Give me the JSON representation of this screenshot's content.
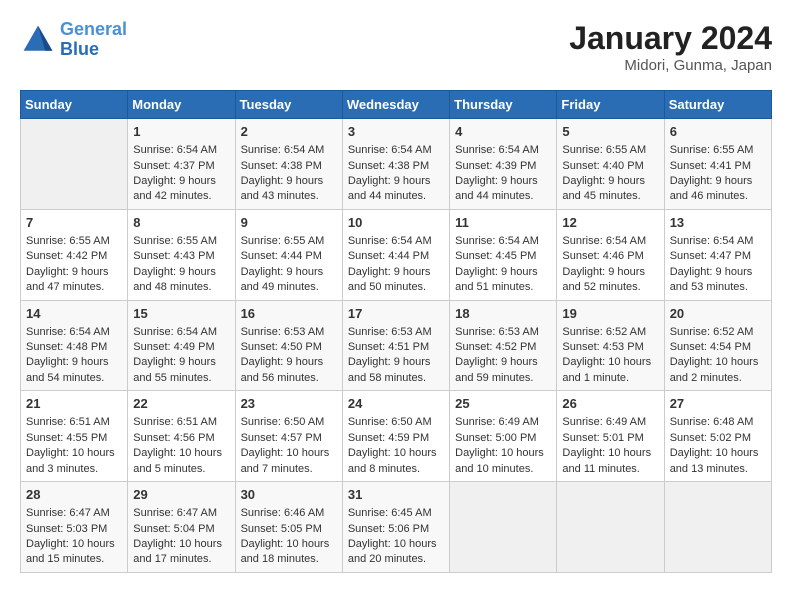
{
  "header": {
    "logo_line1": "General",
    "logo_line2": "Blue",
    "title": "January 2024",
    "subtitle": "Midori, Gunma, Japan"
  },
  "days_of_week": [
    "Sunday",
    "Monday",
    "Tuesday",
    "Wednesday",
    "Thursday",
    "Friday",
    "Saturday"
  ],
  "weeks": [
    [
      {
        "day": "",
        "data": ""
      },
      {
        "day": "1",
        "data": "Sunrise: 6:54 AM\nSunset: 4:37 PM\nDaylight: 9 hours\nand 42 minutes."
      },
      {
        "day": "2",
        "data": "Sunrise: 6:54 AM\nSunset: 4:38 PM\nDaylight: 9 hours\nand 43 minutes."
      },
      {
        "day": "3",
        "data": "Sunrise: 6:54 AM\nSunset: 4:38 PM\nDaylight: 9 hours\nand 44 minutes."
      },
      {
        "day": "4",
        "data": "Sunrise: 6:54 AM\nSunset: 4:39 PM\nDaylight: 9 hours\nand 44 minutes."
      },
      {
        "day": "5",
        "data": "Sunrise: 6:55 AM\nSunset: 4:40 PM\nDaylight: 9 hours\nand 45 minutes."
      },
      {
        "day": "6",
        "data": "Sunrise: 6:55 AM\nSunset: 4:41 PM\nDaylight: 9 hours\nand 46 minutes."
      }
    ],
    [
      {
        "day": "7",
        "data": "Sunrise: 6:55 AM\nSunset: 4:42 PM\nDaylight: 9 hours\nand 47 minutes."
      },
      {
        "day": "8",
        "data": "Sunrise: 6:55 AM\nSunset: 4:43 PM\nDaylight: 9 hours\nand 48 minutes."
      },
      {
        "day": "9",
        "data": "Sunrise: 6:55 AM\nSunset: 4:44 PM\nDaylight: 9 hours\nand 49 minutes."
      },
      {
        "day": "10",
        "data": "Sunrise: 6:54 AM\nSunset: 4:44 PM\nDaylight: 9 hours\nand 50 minutes."
      },
      {
        "day": "11",
        "data": "Sunrise: 6:54 AM\nSunset: 4:45 PM\nDaylight: 9 hours\nand 51 minutes."
      },
      {
        "day": "12",
        "data": "Sunrise: 6:54 AM\nSunset: 4:46 PM\nDaylight: 9 hours\nand 52 minutes."
      },
      {
        "day": "13",
        "data": "Sunrise: 6:54 AM\nSunset: 4:47 PM\nDaylight: 9 hours\nand 53 minutes."
      }
    ],
    [
      {
        "day": "14",
        "data": "Sunrise: 6:54 AM\nSunset: 4:48 PM\nDaylight: 9 hours\nand 54 minutes."
      },
      {
        "day": "15",
        "data": "Sunrise: 6:54 AM\nSunset: 4:49 PM\nDaylight: 9 hours\nand 55 minutes."
      },
      {
        "day": "16",
        "data": "Sunrise: 6:53 AM\nSunset: 4:50 PM\nDaylight: 9 hours\nand 56 minutes."
      },
      {
        "day": "17",
        "data": "Sunrise: 6:53 AM\nSunset: 4:51 PM\nDaylight: 9 hours\nand 58 minutes."
      },
      {
        "day": "18",
        "data": "Sunrise: 6:53 AM\nSunset: 4:52 PM\nDaylight: 9 hours\nand 59 minutes."
      },
      {
        "day": "19",
        "data": "Sunrise: 6:52 AM\nSunset: 4:53 PM\nDaylight: 10 hours\nand 1 minute."
      },
      {
        "day": "20",
        "data": "Sunrise: 6:52 AM\nSunset: 4:54 PM\nDaylight: 10 hours\nand 2 minutes."
      }
    ],
    [
      {
        "day": "21",
        "data": "Sunrise: 6:51 AM\nSunset: 4:55 PM\nDaylight: 10 hours\nand 3 minutes."
      },
      {
        "day": "22",
        "data": "Sunrise: 6:51 AM\nSunset: 4:56 PM\nDaylight: 10 hours\nand 5 minutes."
      },
      {
        "day": "23",
        "data": "Sunrise: 6:50 AM\nSunset: 4:57 PM\nDaylight: 10 hours\nand 7 minutes."
      },
      {
        "day": "24",
        "data": "Sunrise: 6:50 AM\nSunset: 4:59 PM\nDaylight: 10 hours\nand 8 minutes."
      },
      {
        "day": "25",
        "data": "Sunrise: 6:49 AM\nSunset: 5:00 PM\nDaylight: 10 hours\nand 10 minutes."
      },
      {
        "day": "26",
        "data": "Sunrise: 6:49 AM\nSunset: 5:01 PM\nDaylight: 10 hours\nand 11 minutes."
      },
      {
        "day": "27",
        "data": "Sunrise: 6:48 AM\nSunset: 5:02 PM\nDaylight: 10 hours\nand 13 minutes."
      }
    ],
    [
      {
        "day": "28",
        "data": "Sunrise: 6:47 AM\nSunset: 5:03 PM\nDaylight: 10 hours\nand 15 minutes."
      },
      {
        "day": "29",
        "data": "Sunrise: 6:47 AM\nSunset: 5:04 PM\nDaylight: 10 hours\nand 17 minutes."
      },
      {
        "day": "30",
        "data": "Sunrise: 6:46 AM\nSunset: 5:05 PM\nDaylight: 10 hours\nand 18 minutes."
      },
      {
        "day": "31",
        "data": "Sunrise: 6:45 AM\nSunset: 5:06 PM\nDaylight: 10 hours\nand 20 minutes."
      },
      {
        "day": "",
        "data": ""
      },
      {
        "day": "",
        "data": ""
      },
      {
        "day": "",
        "data": ""
      }
    ]
  ]
}
